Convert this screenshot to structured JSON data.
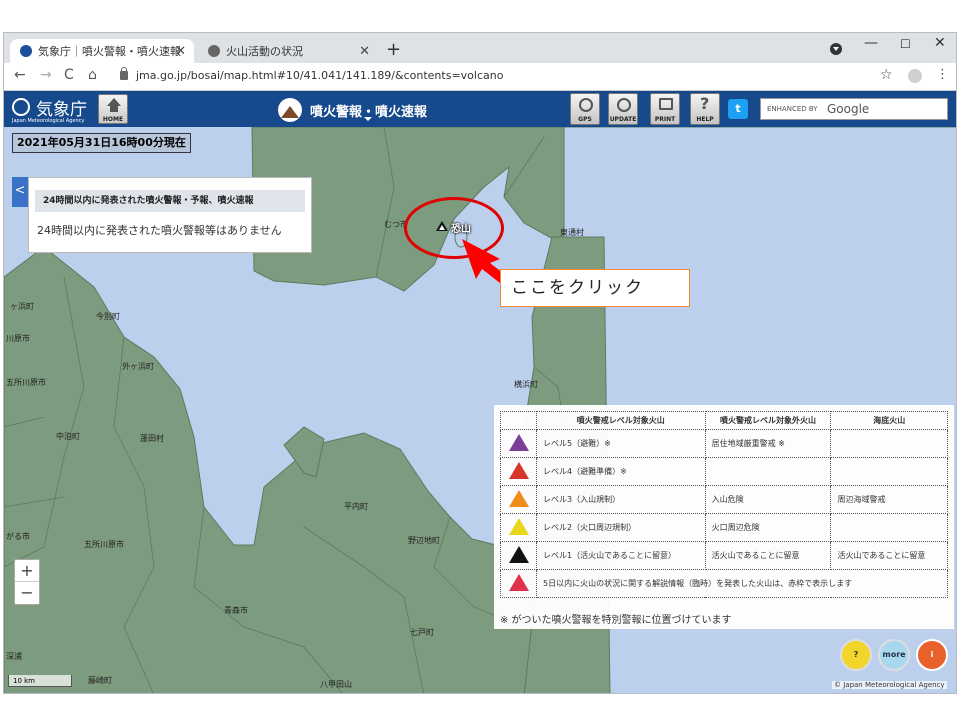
{
  "browser": {
    "tabs": [
      {
        "title": "気象庁｜噴火警報・噴火速報",
        "close": "✕",
        "active": true
      },
      {
        "title": "火山活動の状況",
        "close": "✕",
        "active": false
      }
    ],
    "new_tab": "+",
    "window_controls": {
      "minimize": "—",
      "maximize": "☐",
      "close": "✕"
    },
    "nav": {
      "back": "←",
      "forward": "→",
      "reload": "C",
      "home": "⌂"
    },
    "url": "jma.go.jp/bosai/map.html#10/41.041/141.189/&contents=volcano",
    "bookmark": "☆",
    "menu": "⋮"
  },
  "header": {
    "logo_name": "気象庁",
    "logo_sub": "Japan Meteorological Agency",
    "home_label": "HOME",
    "title": "噴火警報・噴火速報",
    "tools": {
      "gps": "GPS",
      "update": "UPDATE",
      "print": "PRINT",
      "help": "HELP"
    },
    "help_glyph": "?",
    "twitter_glyph": "t",
    "search_prefix": "ENHANCED BY",
    "search_brand": "Google"
  },
  "map": {
    "timestamp": "2021年05月31日16時00分現在",
    "panel_toggle": "<",
    "info_panel": {
      "title": "24時間以内に発表された噴火警報・予報、噴火速報",
      "message": "24時間以内に発表された噴火警報等はありません"
    },
    "volcano_name": "恐山",
    "callout": "ここをクリック",
    "places": [
      {
        "name": "むつ市"
      },
      {
        "name": "東通村"
      },
      {
        "name": "今別町"
      },
      {
        "name": "外ヶ浜町"
      },
      {
        "name": "横浜町"
      },
      {
        "name": "五所川原市"
      },
      {
        "name": "中泊町"
      },
      {
        "name": "蓬田村"
      },
      {
        "name": "平内町"
      },
      {
        "name": "野辺地町"
      },
      {
        "name": "五所川原市"
      },
      {
        "name": "青森市"
      },
      {
        "name": "七戸町"
      },
      {
        "name": "藤崎町"
      },
      {
        "name": "八甲田山"
      },
      {
        "name": "ヶ浜町"
      },
      {
        "name": "川原市"
      },
      {
        "name": "がる市"
      },
      {
        "name": "深浦"
      }
    ],
    "zoom_in": "+",
    "zoom_out": "−",
    "scale": "10 km",
    "copyright": "© Japan Meteorological Agency",
    "round_buttons": {
      "help": "?",
      "more": "more",
      "book": "i"
    }
  },
  "legend": {
    "headers": [
      "噴火警戒レベル対象火山",
      "噴火警戒レベル対象外火山",
      "海底火山"
    ],
    "rows": [
      {
        "color": "#7b3f98",
        "level": "レベル5（避難）※",
        "non_level": "居住地域厳重警戒 ※",
        "submarine": ""
      },
      {
        "color": "#d8352a",
        "level": "レベル4（避難準備）※",
        "non_level": "",
        "submarine": ""
      },
      {
        "color": "#f08c1a",
        "level": "レベル3（入山規制）",
        "non_level": "入山危険",
        "submarine": "周辺海域警戒"
      },
      {
        "color": "#f0e21a",
        "level": "レベル2（火口周辺規制）",
        "non_level": "火口周辺危険",
        "submarine": ""
      },
      {
        "color": "#111111",
        "level": "レベル1（活火山であることに留意）",
        "non_level": "活火山であることに留意",
        "submarine": "活火山であることに留意"
      }
    ],
    "red_row": {
      "color": "#e0304a",
      "text": "5日以内に火山の状況に関する解説情報（臨時）を発表した火山は、赤枠で表示します"
    },
    "note": "※ がついた噴火警報を特別警報に位置づけています"
  }
}
